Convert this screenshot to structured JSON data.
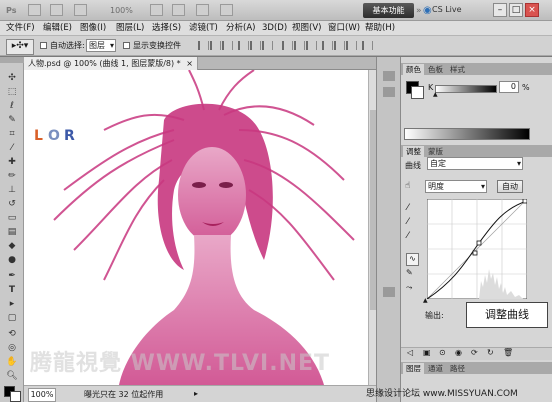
{
  "titlebar": {
    "ps_logo": "Ps",
    "zoom": "100%",
    "workspace_button": "基本功能",
    "cs_live": "CS Live"
  },
  "menu": [
    "文件(F)",
    "编辑(E)",
    "图像(I)",
    "图层(L)",
    "选择(S)",
    "滤镜(T)",
    "分析(A)",
    "3D(D)",
    "视图(V)",
    "窗口(W)",
    "帮助(H)"
  ],
  "options": {
    "auto_select": "自动选择:",
    "auto_select_value": "图层",
    "show_transform": "显示变换控件"
  },
  "document": {
    "tab_label": "人物.psd @ 100% (曲线 1, 图层蒙版/8) *",
    "close": "×",
    "logo_letters": [
      "L",
      "O",
      "R"
    ]
  },
  "statusbar": {
    "zoom": "100%",
    "message": "曝光只在 32 位起作用"
  },
  "color_panel": {
    "tabs": [
      "颜色",
      "色板",
      "样式"
    ],
    "channel": "K",
    "value": "0",
    "unit": "%"
  },
  "adjust_panel": {
    "tabs": [
      "调整",
      "蒙版"
    ],
    "title": "曲线",
    "preset": "自定",
    "channel": "明度",
    "auto_button": "自动",
    "output_label": "输出:"
  },
  "layers_panel": {
    "tabs": [
      "图层",
      "通道",
      "路径"
    ]
  },
  "callout": "调整曲线",
  "watermark": "腾龍視覺 WWW.TLVI.NET",
  "site_watermark": "思缘设计论坛 www.MISSYUAN.COM",
  "colors": {
    "photo_magenta": "#c8377f",
    "canvas_bg": "#ffffff",
    "ui_gray": "#d6d6d6"
  }
}
